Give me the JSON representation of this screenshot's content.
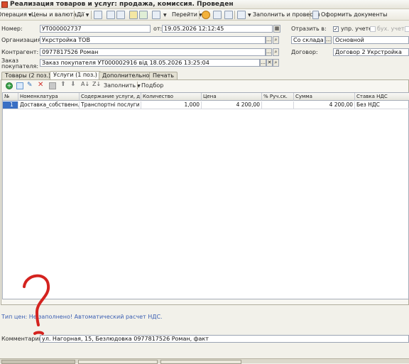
{
  "window": {
    "title": "Реализация товаров и услуг: продажа, комиссия. Проведен"
  },
  "toolbar": {
    "operation": "Операция",
    "prices_currency": "Цены и валюта...",
    "actions": "Дії",
    "goto": "Перейти",
    "fill_and_post": "Заполнить и провести",
    "make_docs": "Оформить документы"
  },
  "form": {
    "number_label": "Номер:",
    "number_value": "УТ000002737",
    "date_label": "от:",
    "date_value": "19.05.2026 12:12:45",
    "reflect_label": "Отразить в:",
    "mgmt_label": "упр. учете",
    "acc_label": "бух. учете",
    "org_label": "Организация:",
    "org_value": "Укрстройка ТОВ",
    "warehouse_value": "Со склада",
    "warehouse_value2": "Основной",
    "contractor_label": "Контрагент:",
    "contractor_value": "0977817526 Роман",
    "contract_label": "Договор:",
    "contract_value": "Договор 2 Укрстройка",
    "order_label_1": "Заказ",
    "order_label_2": "покупателя:",
    "order_value": "Заказ покупателя УТ000002916 від 18.05.2026 13:25:04"
  },
  "tabs": [
    {
      "label": "Товары (2 поз.)"
    },
    {
      "label": "Услуги (1 поз.)"
    },
    {
      "label": "Дополнительно"
    },
    {
      "label": "Печать"
    }
  ],
  "table_toolbar": {
    "fill": "Заполнить",
    "selection": "Подбор"
  },
  "grid": {
    "columns": [
      "№",
      "Номенклатура",
      "Содержание услуги, д...",
      "Количество",
      "Цена",
      "% Руч.ск.",
      "Сумма",
      "Ставка НДС"
    ],
    "rows": [
      [
        "1",
        "Доставка_собственн...",
        "Транспортні послуги",
        "1,000",
        "4 200,00",
        "",
        "4 200,00",
        "Без НДС"
      ]
    ]
  },
  "info_text": "Тип цен: Не заполнено! Автоматический расчет НДС.",
  "comment": {
    "label": "Комментарий:",
    "value": "ул. Нагорная, 15, Безлюдовка 0977817526 Роман, факт"
  },
  "colors": {
    "annotation": "#d4231f",
    "info": "#3b5fb3"
  }
}
